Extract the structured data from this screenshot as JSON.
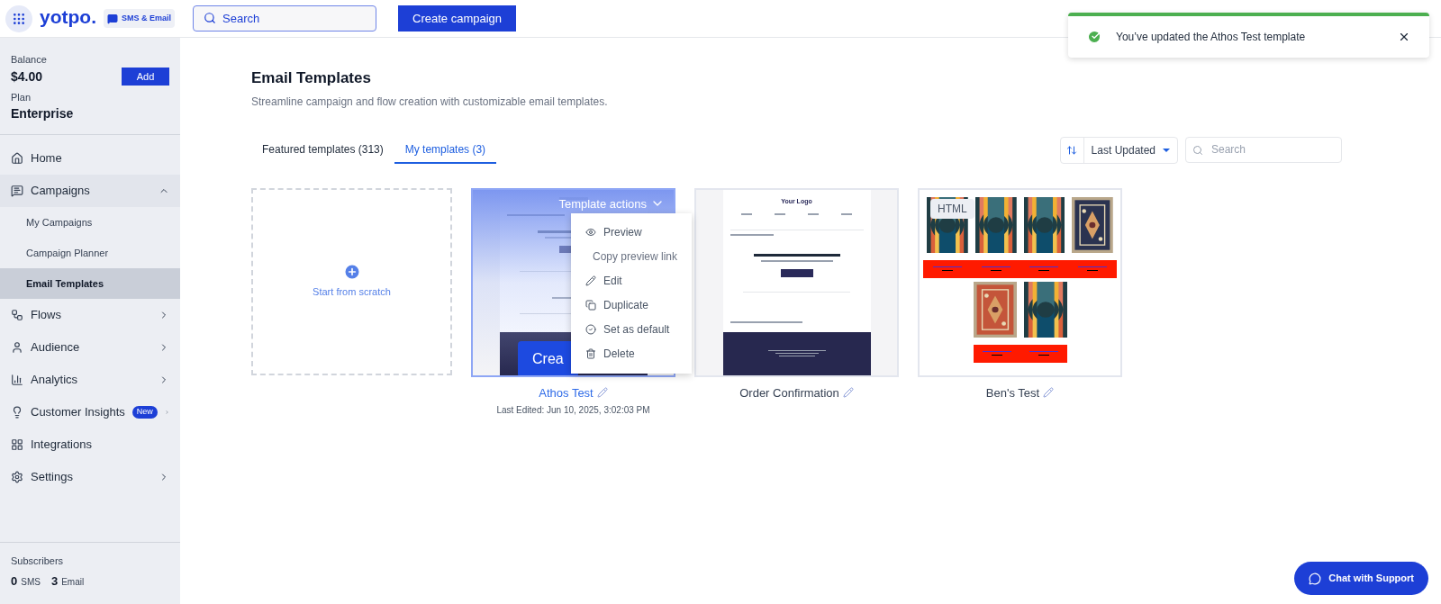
{
  "topbar": {
    "brand": "yotpo.",
    "product": "SMS & Email",
    "search_placeholder": "Search",
    "create_button": "Create campaign"
  },
  "toast": {
    "message": "You’ve updated the Athos Test template"
  },
  "sidebar": {
    "balance_label": "Balance",
    "balance": "$4.00",
    "add_button": "Add",
    "plan_label": "Plan",
    "plan": "Enterprise",
    "items": [
      {
        "kind": "link",
        "label": "Home",
        "selected": false
      },
      {
        "kind": "group",
        "label": "Campaigns",
        "expanded": true,
        "selected": false,
        "children": [
          {
            "label": "My Campaigns",
            "selected": false
          },
          {
            "label": "Campaign Planner",
            "selected": false
          },
          {
            "label": "Email Templates",
            "selected": true
          }
        ]
      },
      {
        "kind": "group",
        "label": "Flows",
        "expanded": false,
        "selected": false
      },
      {
        "kind": "group",
        "label": "Audience",
        "expanded": false,
        "selected": false
      },
      {
        "kind": "group",
        "label": "Analytics",
        "expanded": false,
        "selected": false
      },
      {
        "kind": "group",
        "label": "Customer Insights",
        "badge": "New",
        "expanded": false,
        "selected": false
      },
      {
        "kind": "link",
        "label": "Integrations",
        "selected": false
      },
      {
        "kind": "group",
        "label": "Settings",
        "expanded": false,
        "selected": false
      }
    ],
    "subscribers": {
      "label": "Subscribers",
      "sms_count": "0",
      "sms_label": "SMS",
      "email_count": "3",
      "email_label": "Email"
    }
  },
  "page": {
    "title": "Email Templates",
    "subtitle": "Streamline campaign and flow creation with customizable email templates.",
    "tabs": [
      {
        "label": "Featured templates (313)",
        "selected": false
      },
      {
        "label": "My templates (3)",
        "selected": true
      }
    ],
    "sort": {
      "value": "Last Updated"
    },
    "search": {
      "placeholder": "Search"
    },
    "new_card": {
      "label": "Start from scratch"
    },
    "templates": [
      {
        "name": "Athos Test",
        "kind": "email",
        "hovered": true,
        "last_edited": "Last Edited: Jun 10, 2025, 3:02:03 PM",
        "actions_label": "Template actions",
        "action_button": "Crea",
        "menu": [
          {
            "label": "Preview",
            "disabled": false
          },
          {
            "label": "Copy preview link",
            "disabled": true
          },
          {
            "label": "Edit",
            "disabled": false
          },
          {
            "label": "Duplicate",
            "disabled": false
          },
          {
            "label": "Set as default",
            "disabled": false
          },
          {
            "label": "Delete",
            "disabled": false
          }
        ]
      },
      {
        "name": "Order Confirmation",
        "kind": "email",
        "hovered": false,
        "preview": {
          "logo": "Your Logo"
        }
      },
      {
        "name": "Ben's Test",
        "kind": "html",
        "hovered": false,
        "badge": "HTML"
      }
    ]
  },
  "chat_button": "Chat with Support"
}
